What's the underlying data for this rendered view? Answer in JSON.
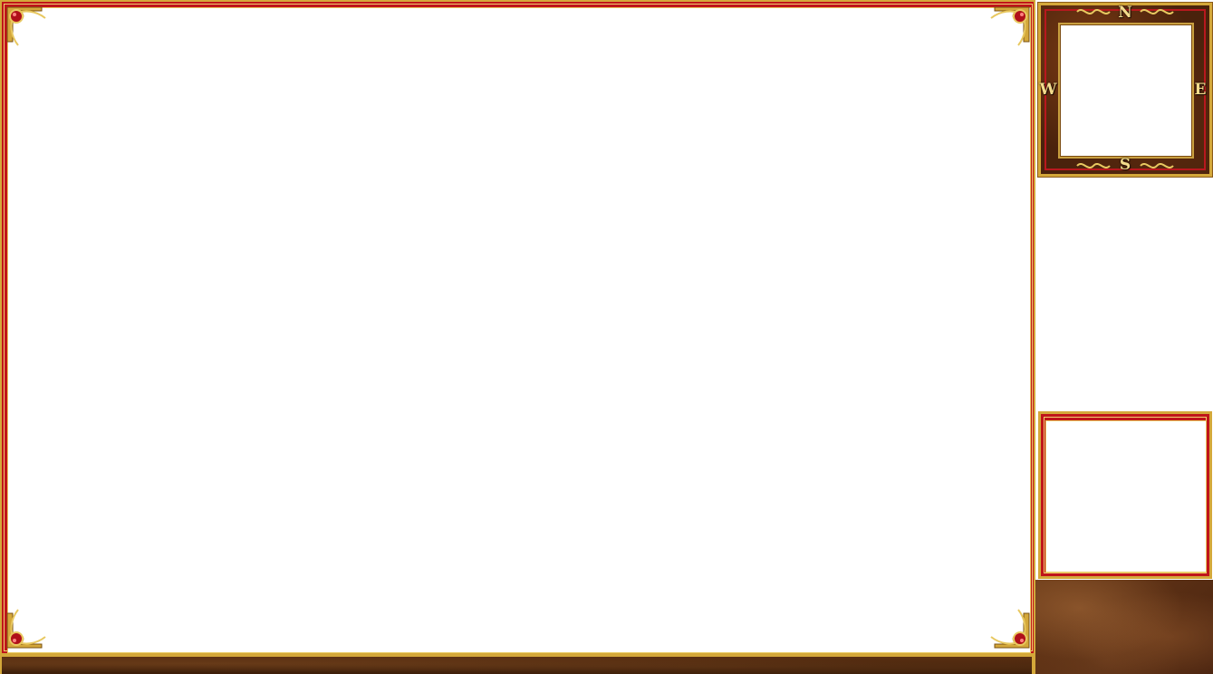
{
  "window": {
    "status_text": ""
  },
  "minimap": {
    "compass": {
      "north": "N",
      "south": "S",
      "west": "W",
      "east": "E"
    }
  },
  "icons": {
    "corner_ornament": "gold-filigree-ruby-icon",
    "compass_knot": "celtic-knot-icon"
  },
  "colors": {
    "frame_red": "#c0141a",
    "frame_gold": "#d4a83a",
    "leather_brown": "#4a220c",
    "viewport": "#ffffff"
  }
}
